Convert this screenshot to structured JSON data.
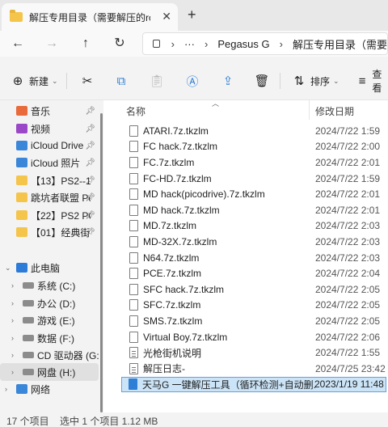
{
  "tab": {
    "title": "解压专用目录（需要解压的rom",
    "close": "✕",
    "new": "+"
  },
  "nav": {
    "back": "←",
    "forward": "→",
    "up": "↑",
    "refresh": "↻"
  },
  "address": {
    "more": "···",
    "segments": [
      "Pegasus G",
      "解压专用目录（需要"
    ],
    "chevron": "›"
  },
  "toolbar": {
    "new_label": "新建",
    "sort_label": "排序",
    "view_label": "查看"
  },
  "sidebar": {
    "items": [
      {
        "label": "音乐",
        "icon": "music-icon",
        "pinned": true
      },
      {
        "label": "视频",
        "icon": "video-icon",
        "pinned": true
      },
      {
        "label": "iCloud Drive",
        "icon": "cloud-icon",
        "pinned": true
      },
      {
        "label": "iCloud 照片",
        "icon": "cloud-icon",
        "pinned": true
      },
      {
        "label": "【13】PS2--1",
        "icon": "folder-icon",
        "pinned": true
      },
      {
        "label": "跳坑者联盟 Pe",
        "icon": "folder-icon",
        "pinned": true
      },
      {
        "label": "【22】PS2 PC",
        "icon": "folder-icon",
        "pinned": true
      },
      {
        "label": "【01】经典街",
        "icon": "folder-icon",
        "pinned": true
      },
      {
        "label": "此电脑",
        "icon": "pc-icon"
      },
      {
        "label": "系统 (C:)",
        "icon": "drive-icon"
      },
      {
        "label": "办公 (D:)",
        "icon": "drive-icon"
      },
      {
        "label": "游戏 (E:)",
        "icon": "drive-icon"
      },
      {
        "label": "数据 (F:)",
        "icon": "drive-icon"
      },
      {
        "label": "CD 驱动器 (G:)",
        "icon": "drive-icon"
      },
      {
        "label": "网盘 (H:)",
        "icon": "drive-icon"
      },
      {
        "label": "网络",
        "icon": "network-icon"
      }
    ]
  },
  "columns": {
    "name": "名称",
    "date": "修改日期"
  },
  "files": [
    {
      "name": "ATARI.7z.tkzlm",
      "date": "2024/7/22 1:59",
      "type": "file"
    },
    {
      "name": "FC hack.7z.tkzlm",
      "date": "2024/7/22 2:00",
      "type": "file"
    },
    {
      "name": "FC.7z.tkzlm",
      "date": "2024/7/22 2:01",
      "type": "file"
    },
    {
      "name": "FC-HD.7z.tkzlm",
      "date": "2024/7/22 1:59",
      "type": "file"
    },
    {
      "name": "MD hack(picodrive).7z.tkzlm",
      "date": "2024/7/22 2:01",
      "type": "file"
    },
    {
      "name": "MD hack.7z.tkzlm",
      "date": "2024/7/22 2:01",
      "type": "file"
    },
    {
      "name": "MD.7z.tkzlm",
      "date": "2024/7/22 2:03",
      "type": "file"
    },
    {
      "name": "MD-32X.7z.tkzlm",
      "date": "2024/7/22 2:03",
      "type": "file"
    },
    {
      "name": "N64.7z.tkzlm",
      "date": "2024/7/22 2:03",
      "type": "file"
    },
    {
      "name": "PCE.7z.tkzlm",
      "date": "2024/7/22 2:04",
      "type": "file"
    },
    {
      "name": "SFC hack.7z.tkzlm",
      "date": "2024/7/22 2:05",
      "type": "file"
    },
    {
      "name": "SFC.7z.tkzlm",
      "date": "2024/7/22 2:05",
      "type": "file"
    },
    {
      "name": "SMS.7z.tkzlm",
      "date": "2024/7/22 2:05",
      "type": "file"
    },
    {
      "name": "Virtual Boy.7z.tkzlm",
      "date": "2024/7/22 2:06",
      "type": "file"
    },
    {
      "name": "光枪街机说明",
      "date": "2024/7/22 1:55",
      "type": "txt"
    },
    {
      "name": "解压日志-",
      "date": "2024/7/25 23:42",
      "type": "txt"
    },
    {
      "name": "天马G 一键解压工具（循环检测+自动删...",
      "date": "2023/1/19 11:48",
      "type": "exe",
      "selected": true
    }
  ],
  "status": {
    "count": "17 个项目",
    "selection": "选中 1 个项目  1.12 MB"
  },
  "colors": {
    "selection": "#cce4f7",
    "folder": "#f4c54a",
    "accent": "#2f7fd6"
  }
}
